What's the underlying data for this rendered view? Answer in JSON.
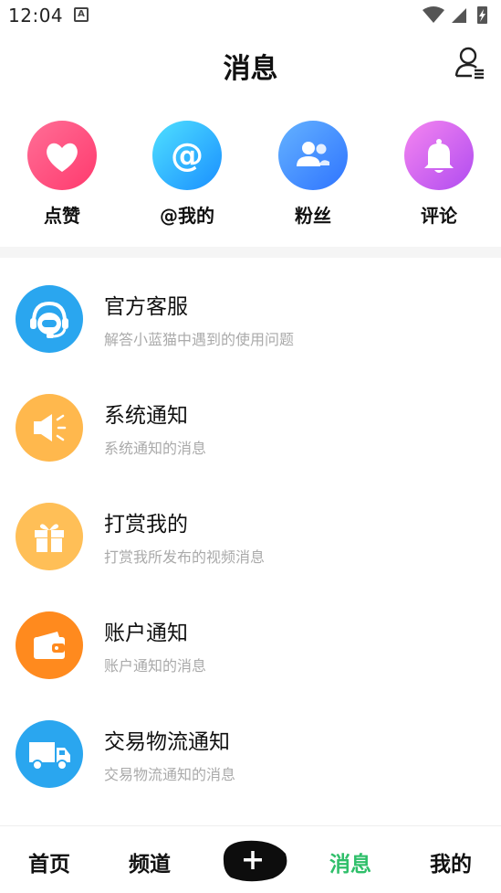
{
  "status_bar": {
    "time": "12:04",
    "notification_letter": "A",
    "icons": [
      "wifi-icon",
      "cell-signal-icon",
      "battery-charging-icon"
    ]
  },
  "header": {
    "title": "消息",
    "right_icon": "contacts-icon"
  },
  "quick_actions": [
    {
      "label": "点赞",
      "icon": "heart-icon",
      "colors": [
        "#ff5f8c",
        "#ff3a6e"
      ]
    },
    {
      "label": "@我的",
      "icon": "at-icon",
      "colors": [
        "#3fd0ff",
        "#1a9bff"
      ]
    },
    {
      "label": "粉丝",
      "icon": "users-icon",
      "colors": [
        "#5aa8ff",
        "#2f7bff"
      ]
    },
    {
      "label": "评论",
      "icon": "bell-icon",
      "colors": [
        "#f07cf0",
        "#b64cf0"
      ]
    }
  ],
  "messages": [
    {
      "title": "官方客服",
      "subtitle": "解答小蓝猫中遇到的使用问题",
      "icon": "headset-icon",
      "color": "#2aa6ef"
    },
    {
      "title": "系统通知",
      "subtitle": "系统通知的消息",
      "icon": "speaker-icon",
      "color": "#ffb84d"
    },
    {
      "title": "打赏我的",
      "subtitle": "打赏我所发布的视频消息",
      "icon": "gift-icon",
      "color": "#ffbf57"
    },
    {
      "title": "账户通知",
      "subtitle": "账户通知的消息",
      "icon": "wallet-icon",
      "color": "#ff8a1e"
    },
    {
      "title": "交易物流通知",
      "subtitle": "交易物流通知的消息",
      "icon": "truck-icon",
      "color": "#2aa6ef"
    }
  ],
  "bottom_nav": {
    "items": [
      "首页",
      "频道",
      "消息",
      "我的"
    ],
    "active": "消息",
    "active_color": "#2fbf6a",
    "center_icon": "plus-icon"
  }
}
